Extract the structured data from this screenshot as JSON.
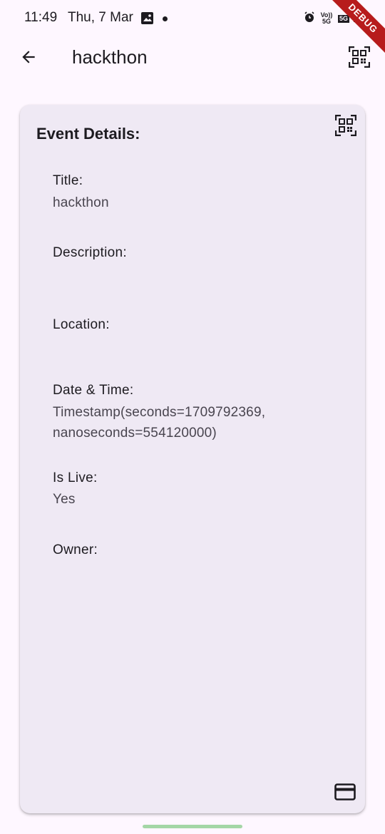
{
  "status_bar": {
    "time": "11:49",
    "date": "Thu, 7 Mar",
    "network_volte": "Vo)) 5G",
    "network_5g": "5G",
    "debug_label": "DEBUG"
  },
  "app_bar": {
    "title": "hackthon",
    "back_icon": "arrow-back-icon",
    "action_icon": "qr-code-scanner-icon"
  },
  "card": {
    "heading": "Event Details:",
    "fields": [
      {
        "label": "Title:",
        "value": "hackthon"
      },
      {
        "label": "Description:",
        "value": ""
      },
      {
        "label": "Location:",
        "value": ""
      },
      {
        "label": "Date & Time:",
        "value": "Timestamp(seconds=1709792369, nanoseconds=554120000)"
      },
      {
        "label": "Is Live:",
        "value": "Yes"
      },
      {
        "label": "Owner:",
        "value": ""
      }
    ],
    "footer_icon": "credit-card-icon"
  },
  "colors": {
    "background": "#fef7ff",
    "card": "#efe9f4",
    "text": "#1d1b20",
    "secondary_text": "#49454f",
    "debug_banner": "#b71c1c",
    "home_indicator": "#a4d6a6"
  }
}
